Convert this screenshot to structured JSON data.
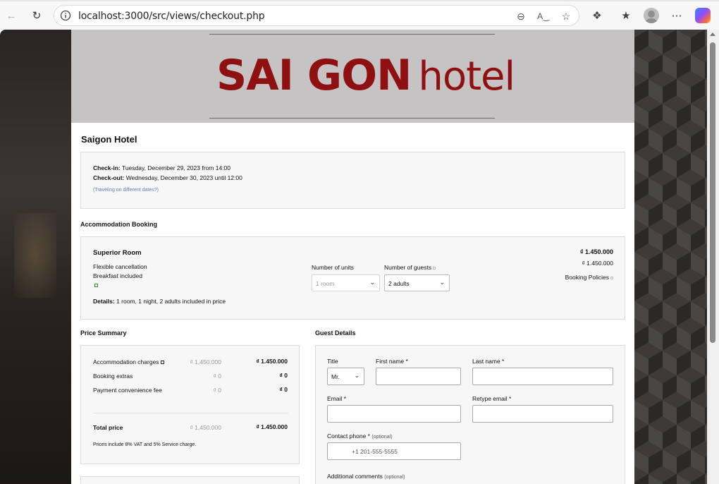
{
  "browser": {
    "url": "localhost:3000/src/views/checkout.php"
  },
  "banner": {
    "logo_part1": "SAI GON",
    "logo_part2": "hotel"
  },
  "hotel_name": "Saigon Hotel",
  "stay": {
    "checkin_label": "Check-in:",
    "checkin_value": "Tuesday, December 29, 2023 from 14:00",
    "checkout_label": "Check-out:",
    "checkout_value": "Wednesday, December 30, 2023 until 12:00",
    "different_dates_link": "(Traveling on different dates?)"
  },
  "accommodation": {
    "section_title": "Accommodation Booking",
    "room_name": "Superior Room",
    "feature1": "Flexible cancellation",
    "feature2": "Breakfast included",
    "units_label": "Number of units",
    "units_value": "1 room",
    "guests_label": "Number of guests",
    "guests_value": "2 adults",
    "price_main": "₫ 1.450.000",
    "price_sub": "₫ 1.450.000",
    "policies_link": "Booking Policies",
    "details_label": "Details:",
    "details_value": "1 room, 1 night, 2 adults included in price"
  },
  "price_summary": {
    "section_title": "Price Summary",
    "rows": [
      {
        "label": "Accommodation charges",
        "original": "₫ 1,450.000",
        "value": "₫ 1.450.000"
      },
      {
        "label": "Booking extras",
        "original": "₫ 0",
        "value": "₫ 0"
      },
      {
        "label": "Payment convenience fee",
        "original": "₫ 0",
        "value": "₫ 0"
      }
    ],
    "total_label": "Total price",
    "total_original": "₫ 1,450.000",
    "total_value": "₫ 1.450.000",
    "tax_note": "Prices include 8% VAT and 5% Service charge."
  },
  "guest_details": {
    "section_title": "Guest Details",
    "title_label": "Title",
    "title_value": "Mr.",
    "first_name_label": "First name *",
    "last_name_label": "Last name *",
    "email_label": "Email *",
    "retype_email_label": "Retype email *",
    "phone_label": "Contact phone *",
    "phone_optional": "(optional)",
    "phone_placeholder": "+1 201-555-5555",
    "comments_label": "Additional comments",
    "comments_optional": "(optional)"
  }
}
